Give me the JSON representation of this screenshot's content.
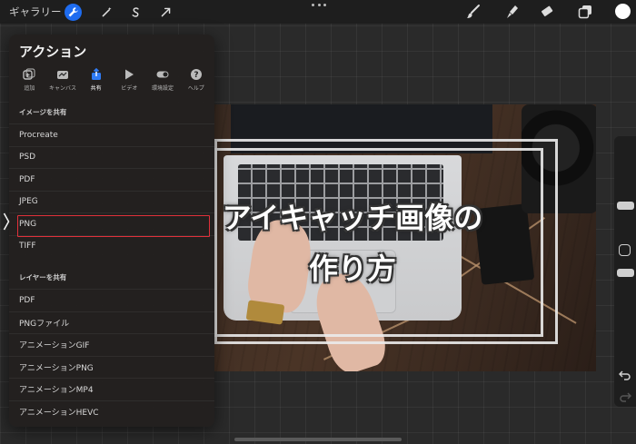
{
  "topbar": {
    "gallery_label": "ギャラリー",
    "tools_left": [
      {
        "name": "actions-wrench-icon",
        "active": true
      },
      {
        "name": "adjustments-wand-icon",
        "active": false
      },
      {
        "name": "selection-s-icon",
        "active": false
      },
      {
        "name": "transform-arrow-icon",
        "active": false
      }
    ],
    "tools_right": [
      "brush-icon",
      "smudge-icon",
      "eraser-icon",
      "layers-icon",
      "color-icon"
    ],
    "accent_color": "#1e6cf0",
    "color_well": "#ffffff"
  },
  "panel": {
    "title": "アクション",
    "tabs": [
      {
        "label": "追加",
        "icon": "add-icon"
      },
      {
        "label": "キャンバス",
        "icon": "canvas-icon"
      },
      {
        "label": "共有",
        "icon": "share-icon",
        "selected": true
      },
      {
        "label": "ビデオ",
        "icon": "video-play-icon"
      },
      {
        "label": "環境設定",
        "icon": "toggle-icon"
      },
      {
        "label": "ヘルプ",
        "icon": "help-icon"
      }
    ],
    "share_image": {
      "header": "イメージを共有",
      "items": [
        "Procreate",
        "PSD",
        "PDF",
        "JPEG",
        "PNG",
        "TIFF"
      ],
      "highlighted": "PNG",
      "highlight_color": "#e0303a"
    },
    "share_layers": {
      "header": "レイヤーを共有",
      "items": [
        "PDF",
        "PNGファイル",
        "アニメーションGIF",
        "アニメーションPNG",
        "アニメーションMP4",
        "アニメーションHEVC"
      ]
    }
  },
  "artwork": {
    "title_line1": "アイキャッチ画像の",
    "title_line2": "作り方"
  }
}
